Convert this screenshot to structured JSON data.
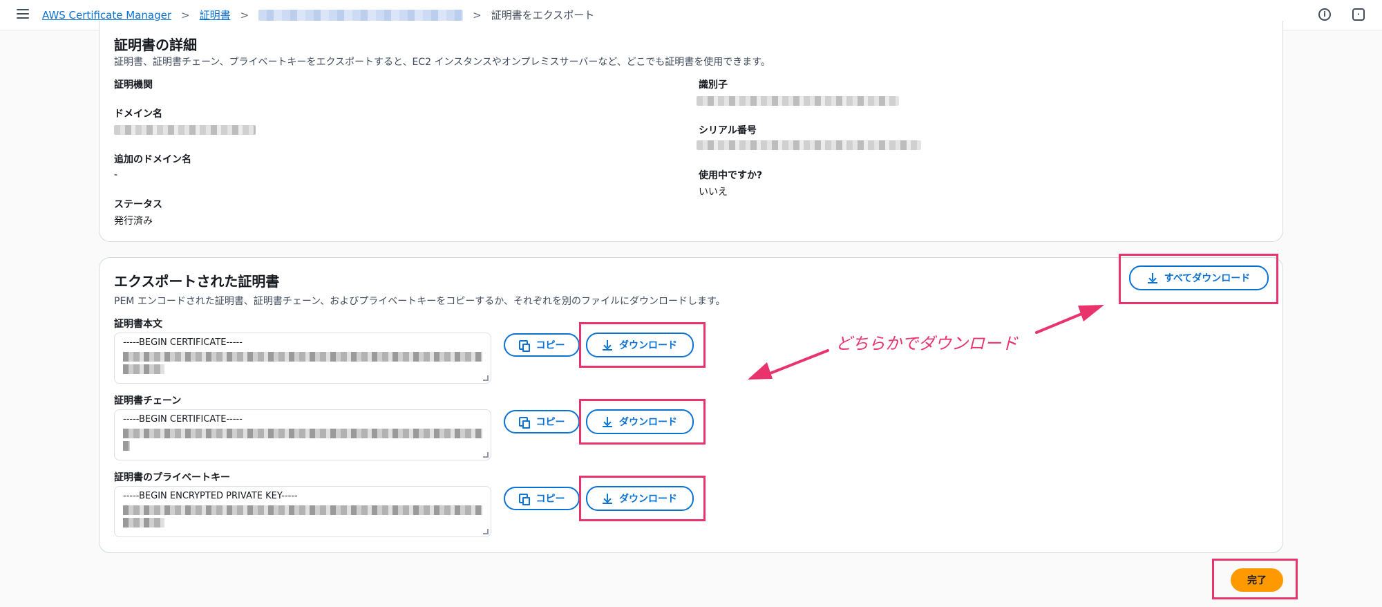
{
  "topbar": {
    "service_link": "AWS Certificate Manager",
    "crumb_certs": "証明書",
    "crumb_current": "証明書をエクスポート",
    "info_icon": "info-icon",
    "settings_icon": "settings-hex-icon"
  },
  "details": {
    "title": "証明書の詳細",
    "description": "証明書、証明書チェーン、プライベートキーをエクスポートすると、EC2 インスタンスやオンプレミスサーバーなど、どこでも証明書を使用できます。",
    "ca_label": "証明機関",
    "domain_label": "ドメイン名",
    "additional_domains_label": "追加のドメイン名",
    "additional_domains_value": "-",
    "status_label": "ステータス",
    "status_value": "発行済み",
    "identifier_label": "識別子",
    "serial_label": "シリアル番号",
    "in_use_label": "使用中ですか?",
    "in_use_value": "いいえ"
  },
  "export": {
    "title": "エクスポートされた証明書",
    "description": "PEM エンコードされた証明書、証明書チェーン、およびプライベートキーをコピーするか、それぞれを別のファイルにダウンロードします。",
    "download_all_label": "すべてダウンロード",
    "items": [
      {
        "label": "証明書本文",
        "header": "-----BEGIN CERTIFICATE-----",
        "copy_label": "コピー",
        "download_label": "ダウンロード"
      },
      {
        "label": "証明書チェーン",
        "header": "-----BEGIN CERTIFICATE-----",
        "copy_label": "コピー",
        "download_label": "ダウンロード"
      },
      {
        "label": "証明書のプライベートキー",
        "header": "-----BEGIN ENCRYPTED PRIVATE KEY-----",
        "copy_label": "コピー",
        "download_label": "ダウンロード"
      }
    ]
  },
  "annotation": "どちらかでダウンロード",
  "footer": {
    "done_label": "完了"
  },
  "colors": {
    "accent": "#0972d3",
    "highlight": "#e8336d",
    "primary_button": "#ff9900"
  }
}
